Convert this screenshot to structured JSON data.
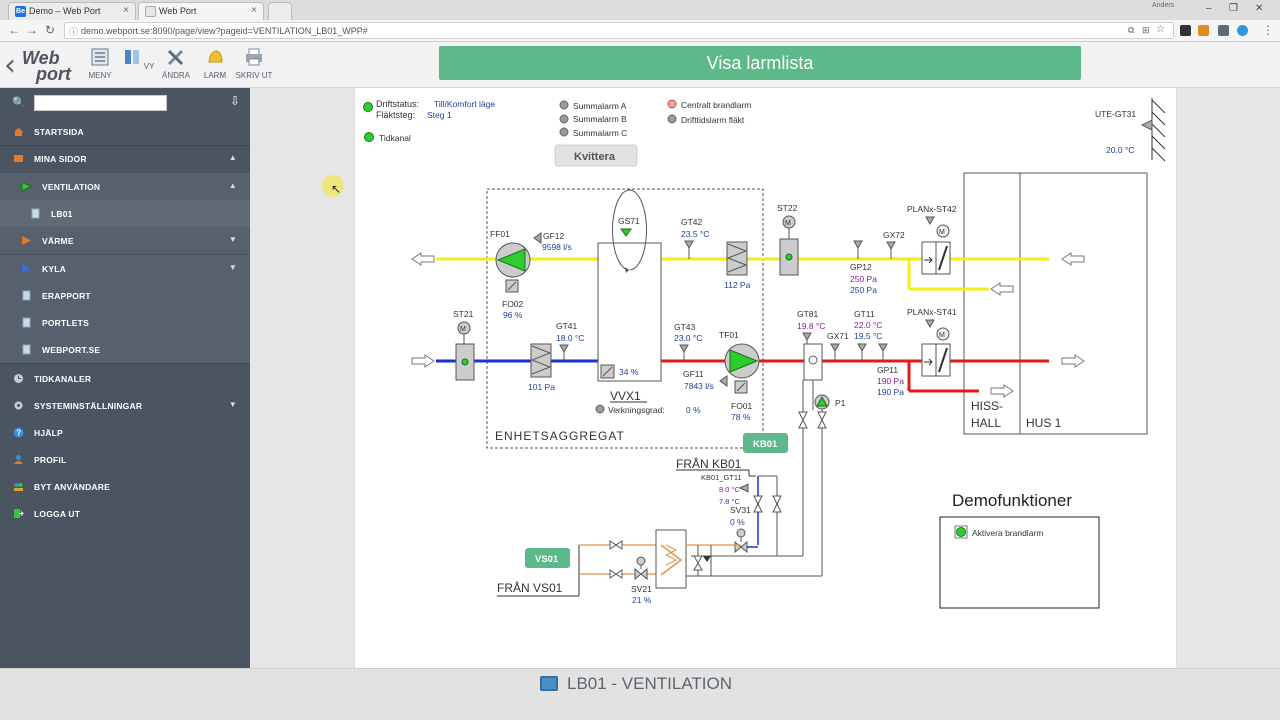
{
  "browser": {
    "tabs": [
      {
        "label": "Demo – Web Port",
        "favicon": "Be",
        "favicon_color": "#1a73e8"
      },
      {
        "label": "Web Port",
        "favicon": "",
        "favicon_color": "#9aa"
      }
    ],
    "url": "demo.webport.se:8090/page/view?pageid=VENTILATION_LB01_WPP#",
    "user_label": "Anders"
  },
  "toolbar": {
    "logo_line1": "Web",
    "logo_line2": "port",
    "buttons": [
      {
        "label": "MENY",
        "icon": "menu-icon"
      },
      {
        "label": "VY",
        "icon": "view-icon"
      },
      {
        "label": "ÄNDRA",
        "icon": "tools-icon"
      },
      {
        "label": "LARM",
        "icon": "bell-icon"
      },
      {
        "label": "SKRIV UT",
        "icon": "printer-icon"
      }
    ],
    "alarm_list_label": "Visa larmlista"
  },
  "sidebar": {
    "search_placeholder": "",
    "items": [
      {
        "label": "STARTSIDA",
        "icon": "home-icon"
      },
      {
        "label": "MINA SIDOR",
        "icon": "folder-icon",
        "expanded": true
      },
      {
        "label": "VENTILATION",
        "icon": "play-green-icon",
        "expanded": true
      },
      {
        "label": "LB01",
        "icon": "page-icon"
      },
      {
        "label": "VÄRME",
        "icon": "play-orange-icon"
      },
      {
        "label": "KYLA",
        "icon": "play-blue-icon"
      },
      {
        "label": "ERAPPORT",
        "icon": "page-icon"
      },
      {
        "label": "PORTLETS",
        "icon": "page-icon"
      },
      {
        "label": "WEBPORT.SE",
        "icon": "page-icon"
      },
      {
        "label": "TIDKANALER",
        "icon": "clock-icon"
      },
      {
        "label": "SYSTEMINSTÄLLNINGAR",
        "icon": "gear-icon"
      },
      {
        "label": "HJÄLP",
        "icon": "help-icon"
      },
      {
        "label": "PROFIL",
        "icon": "user-icon"
      },
      {
        "label": "BYT ANVÄNDARE",
        "icon": "users-icon"
      },
      {
        "label": "LOGGA UT",
        "icon": "logout-icon"
      }
    ]
  },
  "scada": {
    "status": {
      "driftstatus_label": "Driftstatus:",
      "driftstatus_value": "Till/Komfort läge",
      "flaktsteg_label": "Fläktsteg:",
      "flaktsteg_value": "Steg 1",
      "tidkanal": "Tidkanal"
    },
    "alarms": [
      "Summalarm A",
      "Summalarm B",
      "Summalarm C"
    ],
    "alarms2": [
      "Centralt brandlarm",
      "Drifttidslarm fläkt"
    ],
    "kvittera": "Kvittera",
    "outdoor": {
      "tag": "UTE-GT31",
      "value": "20.0 °C"
    },
    "unit_label": "ENHETSAGGREGAT",
    "ff01": {
      "tag": "FF01",
      "fo_tag": "FO02",
      "fo_value": "96 %"
    },
    "gf12": {
      "tag": "GF12",
      "value": "9598 l/s"
    },
    "gs71": {
      "tag": "GS71"
    },
    "gt42": {
      "tag": "GT42",
      "value": "23.5 °C"
    },
    "filter_supply": {
      "value": "112 Pa"
    },
    "st22": {
      "tag": "ST22"
    },
    "gp12": {
      "tag": "GP12",
      "value1": "250 Pa",
      "value2": "250 Pa"
    },
    "gx72": {
      "tag": "GX72"
    },
    "plan42": {
      "tag": "PLANx-ST42"
    },
    "st21": {
      "tag": "ST21"
    },
    "filter_extract": {
      "value": "101 Pa"
    },
    "gt41": {
      "tag": "GT41",
      "value": "18.0 °C"
    },
    "vvx": {
      "tag": "VVX1",
      "pct": "34 %",
      "eff_label": "Verkningsgrad:",
      "eff_value": "0 %"
    },
    "gt43": {
      "tag": "GT43",
      "value": "23.0 °C"
    },
    "tf01": {
      "tag": "TF01",
      "fo_tag": "FO01",
      "fo_value": "78 %"
    },
    "gf11": {
      "tag": "GF11",
      "value": "7843 l/s"
    },
    "gt81": {
      "tag": "GT81",
      "value": "19.8 °C"
    },
    "gx71": {
      "tag": "GX71"
    },
    "gt11": {
      "tag": "GT11",
      "value1": "22.0 °C",
      "value2": "19.5 °C"
    },
    "gp11": {
      "tag": "GP11",
      "value1": "190 Pa",
      "value2": "190 Pa"
    },
    "plan41": {
      "tag": "PLANx-ST41"
    },
    "p1": {
      "tag": "P1"
    },
    "kb01": {
      "badge": "KB01",
      "title": "FRÅN KB01",
      "gt": "KB01_GT11",
      "v1": "8.0 °C",
      "v2": "7.8 °C",
      "sv": "SV31",
      "sv_value": "0 %"
    },
    "vs01": {
      "badge": "VS01",
      "title": "FRÅN VS01",
      "sv": "SV21",
      "sv_value": "21 %"
    },
    "hus": {
      "hiss1": "HISS-",
      "hiss2": "HALL",
      "hus": "HUS 1"
    },
    "demo": {
      "title": "Demofunktioner",
      "item": "Aktivera brandlarm"
    }
  },
  "footer": {
    "page_title": "LB01 - VENTILATION"
  },
  "colors": {
    "supply_air": "#f5ee10",
    "hot": "#e21a1a",
    "cold": "#1a2fd6",
    "pipe_orange": "#e0954a",
    "green": "#2ecc2e",
    "accent": "#5db98a",
    "sidebar": "#4a5561",
    "value_blue": "#1f3f9a",
    "value_purple": "#8b1b9a"
  }
}
